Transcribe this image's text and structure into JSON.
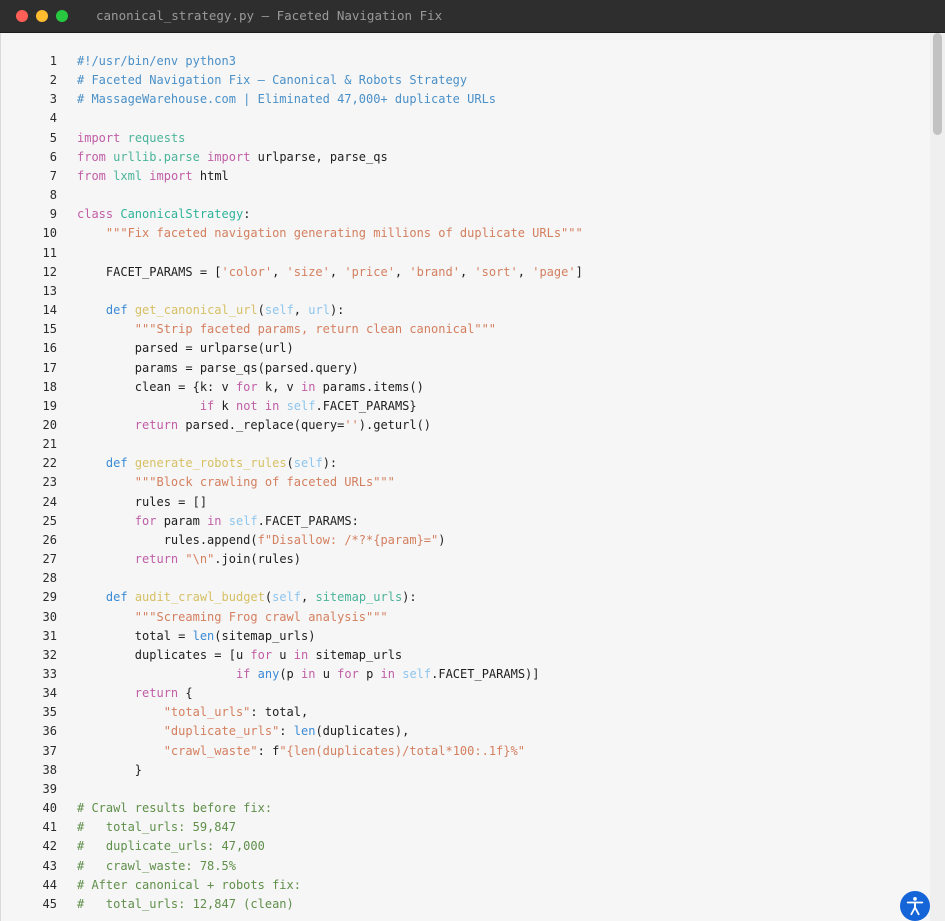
{
  "window": {
    "title": "canonical_strategy.py — Faceted Navigation Fix"
  },
  "editor": {
    "lines": [
      [
        [
          "#!/usr/bin/env python3",
          "tk-comment"
        ]
      ],
      [
        [
          "# Faceted Navigation Fix — Canonical & Robots Strategy",
          "tk-comment"
        ]
      ],
      [
        [
          "# MassageWarehouse.com | Eliminated 47,000+ duplicate URLs",
          "tk-comment"
        ]
      ],
      [],
      [
        [
          "import",
          "tk-kw"
        ],
        [
          " ",
          "tk-plain"
        ],
        [
          "requests",
          "tk-mod"
        ]
      ],
      [
        [
          "from",
          "tk-kw"
        ],
        [
          " ",
          "tk-plain"
        ],
        [
          "urllib.parse",
          "tk-mod"
        ],
        [
          " ",
          "tk-plain"
        ],
        [
          "import",
          "tk-kw"
        ],
        [
          " urlparse, parse_qs",
          "tk-plain"
        ]
      ],
      [
        [
          "from",
          "tk-kw"
        ],
        [
          " ",
          "tk-plain"
        ],
        [
          "lxml",
          "tk-mod"
        ],
        [
          " ",
          "tk-plain"
        ],
        [
          "import",
          "tk-kw"
        ],
        [
          " html",
          "tk-plain"
        ]
      ],
      [],
      [
        [
          "class",
          "tk-kw"
        ],
        [
          " ",
          "tk-plain"
        ],
        [
          "CanonicalStrategy",
          "tk-cls"
        ],
        [
          ":",
          "tk-plain"
        ]
      ],
      [
        [
          "    ",
          "tk-plain"
        ],
        [
          "\"\"\"Fix faceted navigation generating millions of duplicate URLs\"\"\"",
          "tk-str"
        ]
      ],
      [],
      [
        [
          "    FACET_PARAMS = [",
          "tk-plain"
        ],
        [
          "'color'",
          "tk-str"
        ],
        [
          ", ",
          "tk-plain"
        ],
        [
          "'size'",
          "tk-str"
        ],
        [
          ", ",
          "tk-plain"
        ],
        [
          "'price'",
          "tk-str"
        ],
        [
          ", ",
          "tk-plain"
        ],
        [
          "'brand'",
          "tk-str"
        ],
        [
          ", ",
          "tk-plain"
        ],
        [
          "'sort'",
          "tk-str"
        ],
        [
          ", ",
          "tk-plain"
        ],
        [
          "'page'",
          "tk-str"
        ],
        [
          "]",
          "tk-plain"
        ]
      ],
      [],
      [
        [
          "    ",
          "tk-plain"
        ],
        [
          "def",
          "tk-def"
        ],
        [
          " ",
          "tk-plain"
        ],
        [
          "get_canonical_url",
          "tk-fn"
        ],
        [
          "(",
          "tk-plain"
        ],
        [
          "self",
          "tk-self"
        ],
        [
          ", ",
          "tk-plain"
        ],
        [
          "url",
          "tk-self"
        ],
        [
          "):",
          "tk-plain"
        ]
      ],
      [
        [
          "        ",
          "tk-plain"
        ],
        [
          "\"\"\"Strip faceted params, return clean canonical\"\"\"",
          "tk-str"
        ]
      ],
      [
        [
          "        parsed = urlparse(url)",
          "tk-plain"
        ]
      ],
      [
        [
          "        params = parse_qs(parsed.query)",
          "tk-plain"
        ]
      ],
      [
        [
          "        clean = {k: v ",
          "tk-plain"
        ],
        [
          "for",
          "tk-kw"
        ],
        [
          " k, v ",
          "tk-plain"
        ],
        [
          "in",
          "tk-kw"
        ],
        [
          " params.items()",
          "tk-plain"
        ]
      ],
      [
        [
          "                 ",
          "tk-plain"
        ],
        [
          "if",
          "tk-kw"
        ],
        [
          " k ",
          "tk-plain"
        ],
        [
          "not in",
          "tk-kw"
        ],
        [
          " ",
          "tk-plain"
        ],
        [
          "self",
          "tk-self"
        ],
        [
          ".FACET_PARAMS}",
          "tk-plain"
        ]
      ],
      [
        [
          "        ",
          "tk-plain"
        ],
        [
          "return",
          "tk-kw"
        ],
        [
          " parsed._replace(query=",
          "tk-plain"
        ],
        [
          "''",
          "tk-str"
        ],
        [
          ").geturl()",
          "tk-plain"
        ]
      ],
      [],
      [
        [
          "    ",
          "tk-plain"
        ],
        [
          "def",
          "tk-def"
        ],
        [
          " ",
          "tk-plain"
        ],
        [
          "generate_robots_rules",
          "tk-fn"
        ],
        [
          "(",
          "tk-plain"
        ],
        [
          "self",
          "tk-self"
        ],
        [
          "):",
          "tk-plain"
        ]
      ],
      [
        [
          "        ",
          "tk-plain"
        ],
        [
          "\"\"\"Block crawling of faceted URLs\"\"\"",
          "tk-str"
        ]
      ],
      [
        [
          "        rules = []",
          "tk-plain"
        ]
      ],
      [
        [
          "        ",
          "tk-plain"
        ],
        [
          "for",
          "tk-kw"
        ],
        [
          " param ",
          "tk-plain"
        ],
        [
          "in",
          "tk-kw"
        ],
        [
          " ",
          "tk-plain"
        ],
        [
          "self",
          "tk-self"
        ],
        [
          ".FACET_PARAMS:",
          "tk-plain"
        ]
      ],
      [
        [
          "            rules.append(",
          "tk-plain"
        ],
        [
          "f\"Disallow: /*?*{param}=\"",
          "tk-str"
        ],
        [
          ")",
          "tk-plain"
        ]
      ],
      [
        [
          "        ",
          "tk-plain"
        ],
        [
          "return",
          "tk-kw"
        ],
        [
          " ",
          "tk-plain"
        ],
        [
          "\"\\n\"",
          "tk-str"
        ],
        [
          ".join(rules)",
          "tk-plain"
        ]
      ],
      [],
      [
        [
          "    ",
          "tk-plain"
        ],
        [
          "def",
          "tk-def"
        ],
        [
          " ",
          "tk-plain"
        ],
        [
          "audit_crawl_budget",
          "tk-fn"
        ],
        [
          "(",
          "tk-plain"
        ],
        [
          "self",
          "tk-self"
        ],
        [
          ", ",
          "tk-plain"
        ],
        [
          "sitemap_urls",
          "tk-mod"
        ],
        [
          "):",
          "tk-plain"
        ]
      ],
      [
        [
          "        ",
          "tk-plain"
        ],
        [
          "\"\"\"Screaming Frog crawl analysis\"\"\"",
          "tk-str"
        ]
      ],
      [
        [
          "        total = ",
          "tk-plain"
        ],
        [
          "len",
          "tk-builtin"
        ],
        [
          "(sitemap_urls)",
          "tk-plain"
        ]
      ],
      [
        [
          "        duplicates = [u ",
          "tk-plain"
        ],
        [
          "for",
          "tk-kw"
        ],
        [
          " u ",
          "tk-plain"
        ],
        [
          "in",
          "tk-kw"
        ],
        [
          " sitemap_urls",
          "tk-plain"
        ]
      ],
      [
        [
          "                      ",
          "tk-plain"
        ],
        [
          "if",
          "tk-kw"
        ],
        [
          " ",
          "tk-plain"
        ],
        [
          "any",
          "tk-builtin"
        ],
        [
          "(p ",
          "tk-plain"
        ],
        [
          "in",
          "tk-kw"
        ],
        [
          " u ",
          "tk-plain"
        ],
        [
          "for",
          "tk-kw"
        ],
        [
          " p ",
          "tk-plain"
        ],
        [
          "in",
          "tk-kw"
        ],
        [
          " ",
          "tk-plain"
        ],
        [
          "self",
          "tk-self"
        ],
        [
          ".FACET_PARAMS)]",
          "tk-plain"
        ]
      ],
      [
        [
          "        ",
          "tk-plain"
        ],
        [
          "return",
          "tk-kw"
        ],
        [
          " {",
          "tk-plain"
        ]
      ],
      [
        [
          "            ",
          "tk-plain"
        ],
        [
          "\"total_urls\"",
          "tk-str"
        ],
        [
          ": total,",
          "tk-plain"
        ]
      ],
      [
        [
          "            ",
          "tk-plain"
        ],
        [
          "\"duplicate_urls\"",
          "tk-str"
        ],
        [
          ": ",
          "tk-plain"
        ],
        [
          "len",
          "tk-builtin"
        ],
        [
          "(duplicates),",
          "tk-plain"
        ]
      ],
      [
        [
          "            ",
          "tk-plain"
        ],
        [
          "\"crawl_waste\"",
          "tk-str"
        ],
        [
          ": f",
          "tk-plain"
        ],
        [
          "\"{len(duplicates)/total*100:.1f}%\"",
          "tk-str"
        ]
      ],
      [
        [
          "        }",
          "tk-plain"
        ]
      ],
      [],
      [
        [
          "# Crawl results before fix:",
          "tk-comment2"
        ]
      ],
      [
        [
          "#   total_urls: 59,847",
          "tk-comment2"
        ]
      ],
      [
        [
          "#   duplicate_urls: 47,000",
          "tk-comment2"
        ]
      ],
      [
        [
          "#   crawl_waste: 78.5%",
          "tk-comment2"
        ]
      ],
      [
        [
          "# After canonical + robots fix:",
          "tk-comment2"
        ]
      ],
      [
        [
          "#   total_urls: 12,847 (clean)",
          "tk-comment2"
        ]
      ]
    ]
  },
  "icons": {
    "accessibility": "accessibility-person-icon"
  },
  "colors": {
    "titlebar": "#2e2e2e",
    "editor_bg": "#f6f6f6",
    "accent": "#1565d8"
  }
}
